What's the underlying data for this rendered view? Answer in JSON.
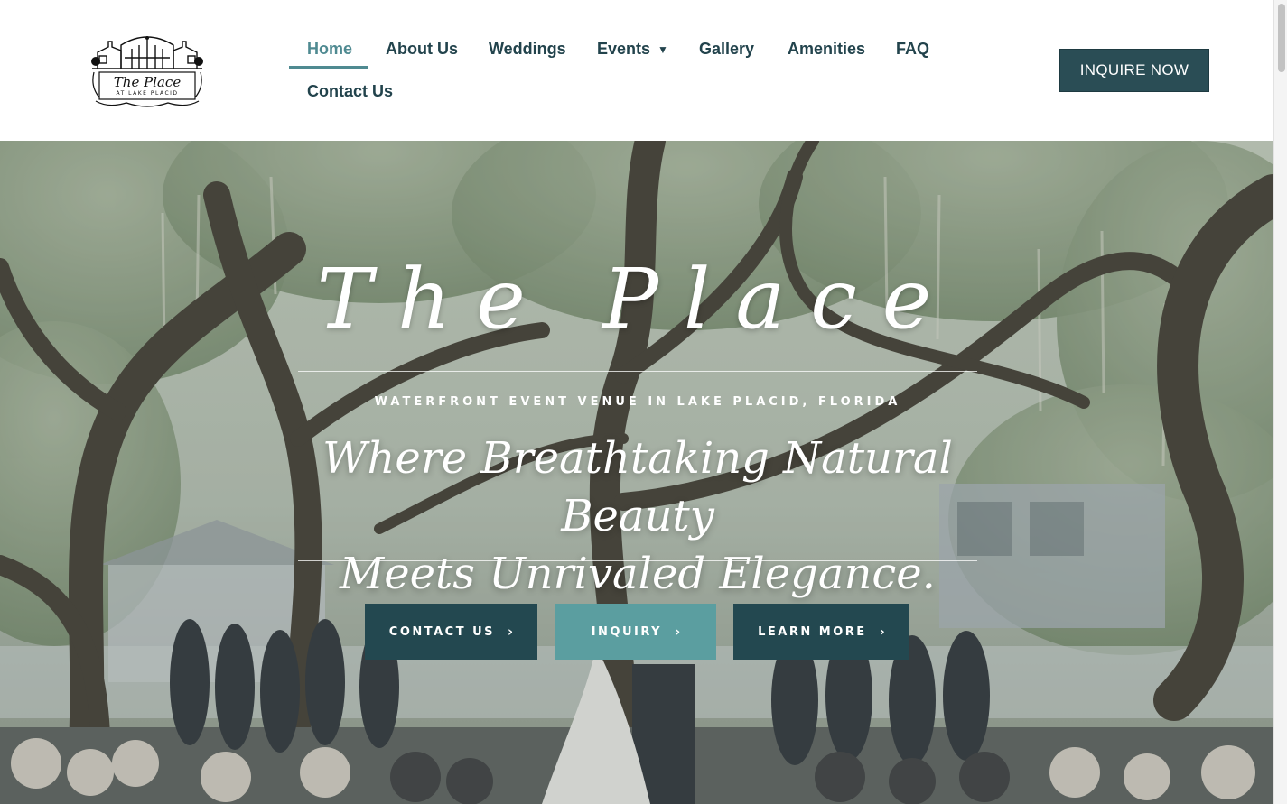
{
  "header": {
    "logo_text": "The Place",
    "logo_subtext": "AT LAKE PLACID",
    "nav": [
      {
        "label": "Home",
        "active": true
      },
      {
        "label": "About Us"
      },
      {
        "label": "Weddings"
      },
      {
        "label": "Events",
        "has_dropdown": true
      },
      {
        "label": "Gallery"
      },
      {
        "label": "Amenities"
      },
      {
        "label": "FAQ"
      },
      {
        "label": "Contact Us"
      }
    ],
    "inquire_button": "INQUIRE NOW"
  },
  "hero": {
    "script_title": "The Place",
    "subtitle": "WATERFRONT EVENT VENUE IN LAKE PLACID, FLORIDA",
    "tagline_line1": "Where Breathtaking Natural Beauty",
    "tagline_line2": "Meets Unrivaled Elegance.",
    "buttons": [
      {
        "label": "CONTACT US",
        "icon": "chevron-right-icon"
      },
      {
        "label": "INQUIRY",
        "icon": "chevron-right-icon"
      },
      {
        "label": "LEARN MORE",
        "icon": "chevron-right-icon"
      }
    ]
  },
  "colors": {
    "nav_text": "#22434c",
    "nav_active": "#4f8a91",
    "primary_button": "#2a4d55",
    "accent_button": "#5b9ea0"
  }
}
